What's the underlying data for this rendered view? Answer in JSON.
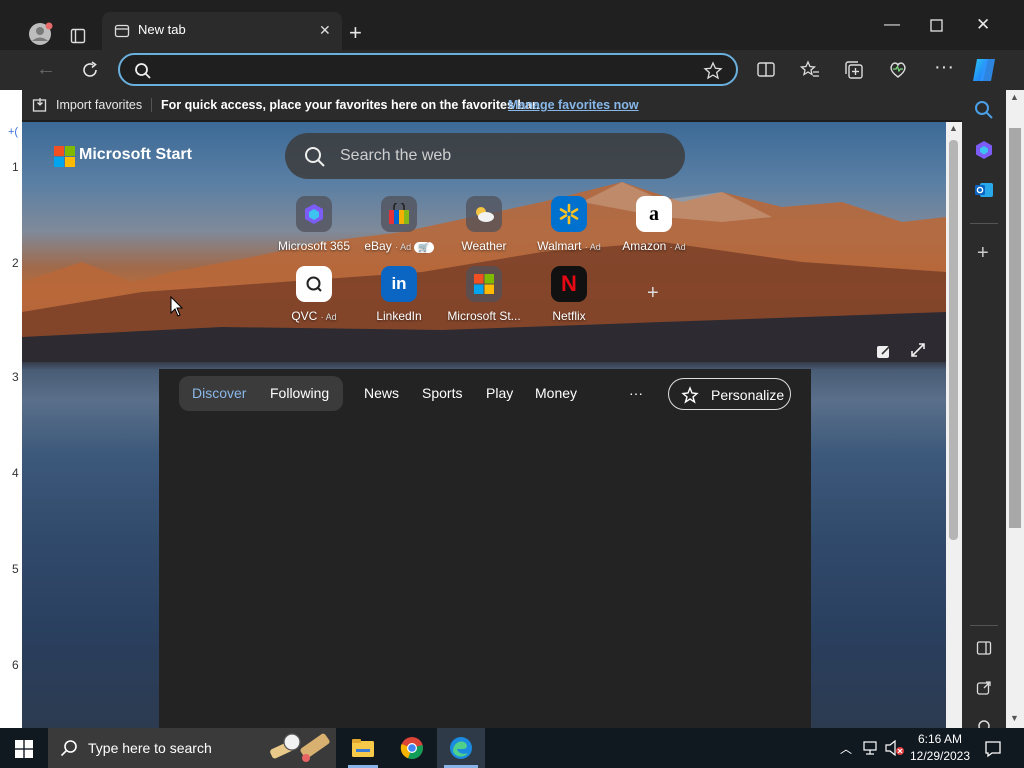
{
  "browser": {
    "tab_title": "New tab",
    "address_value": "",
    "address_placeholder": ""
  },
  "favorites_bar": {
    "import_label": "Import favorites",
    "hint": "For quick access, place your favorites here on the favorites bar.",
    "manage_link": "Manage favorites now"
  },
  "start": {
    "brand": "Microsoft Start",
    "search_placeholder": "Search the web",
    "tiles": [
      {
        "label": "Microsoft 365",
        "ad": "",
        "icon": "microsoft-365-icon"
      },
      {
        "label": "eBay",
        "ad": "· Ad",
        "icon": "ebay-icon"
      },
      {
        "label": "Weather",
        "ad": "",
        "icon": "weather-icon"
      },
      {
        "label": "Walmart",
        "ad": "· Ad",
        "icon": "walmart-icon"
      },
      {
        "label": "Amazon",
        "ad": "· Ad",
        "icon": "amazon-icon"
      },
      {
        "label": "QVC",
        "ad": "· Ad",
        "icon": "qvc-icon"
      },
      {
        "label": "LinkedIn",
        "ad": "",
        "icon": "linkedin-icon"
      },
      {
        "label": "Microsoft St...",
        "ad": "",
        "icon": "microsoft-store-icon"
      },
      {
        "label": "Netflix",
        "ad": "",
        "icon": "netflix-icon"
      }
    ]
  },
  "feed": {
    "tabs": [
      "Discover",
      "Following",
      "News",
      "Sports",
      "Play",
      "Money"
    ],
    "more": "···",
    "personalize": "Personalize"
  },
  "left_strip": [
    "1",
    "2",
    "3",
    "4",
    "5",
    "6"
  ],
  "taskbar": {
    "search_placeholder": "Type here to search",
    "time": "6:16 AM",
    "date": "12/29/2023"
  },
  "colors": {
    "accent_link": "#86b7e8",
    "address_border": "#6ab0de",
    "feed_bg": "#232323"
  }
}
